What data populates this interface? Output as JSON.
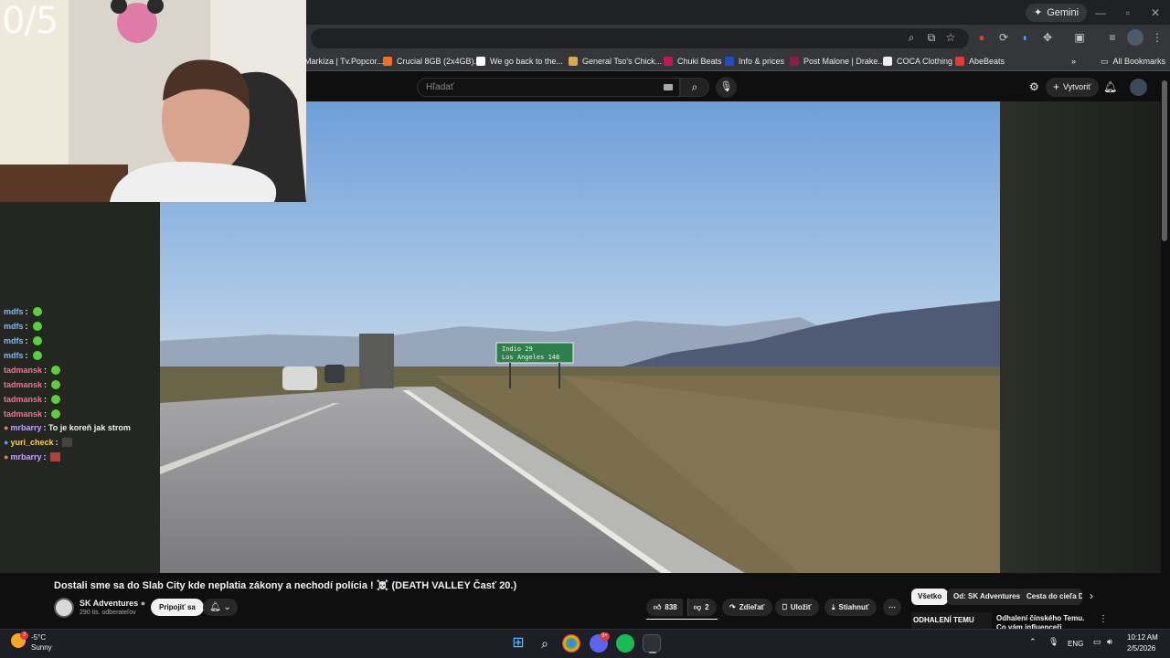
{
  "browser": {
    "gemini_label": "Gemini",
    "bookmarks": [
      "Markíza | Tv.Popcor...",
      "Crucial 8GB (2x4GB)...",
      "We go back to the...",
      "General Tso's Chick...",
      "Chuki Beats",
      "Info & prices",
      "Post Malone | Drake...",
      "COCA Clothing",
      "AbeBeats"
    ],
    "all_bookmarks": "All Bookmarks"
  },
  "youtube": {
    "search_placeholder": "Hľadať",
    "create_label": "Vytvoriť"
  },
  "stream_overlay": {
    "counter": "0/5",
    "chat": [
      {
        "user": "mdfs",
        "text": ":",
        "color": "#7db8ff",
        "emote": true
      },
      {
        "user": "mdfs",
        "text": ":",
        "color": "#7db8ff",
        "emote": true
      },
      {
        "user": "mdfs",
        "text": ":",
        "color": "#7db8ff",
        "emote": true
      },
      {
        "user": "mdfs",
        "text": ":",
        "color": "#7db8ff",
        "emote": true
      },
      {
        "user": "tadmansk",
        "text": ":",
        "color": "#ff6b8a",
        "emote": true
      },
      {
        "user": "tadmansk",
        "text": ":",
        "color": "#ff6b8a",
        "emote": true
      },
      {
        "user": "tadmansk",
        "text": ":",
        "color": "#ff6b8a",
        "emote": true
      },
      {
        "user": "tadmansk",
        "text": ":",
        "color": "#ff6b8a",
        "emote": true
      },
      {
        "user": "mrbarry",
        "text": ": To je koreň jak strom",
        "color": "#c9a3ff",
        "emote": false
      },
      {
        "user": "yuri_check",
        "text": ":",
        "color": "#ffd24d",
        "emote": false
      },
      {
        "user": "mrbarry",
        "text": ":",
        "color": "#c9a3ff",
        "emote": false
      }
    ]
  },
  "video": {
    "sign_lines": [
      "Indio 29",
      "Los Angeles 148"
    ],
    "title": "Dostali sme sa do Slab City kde neplatia zákony a nechodí polícia ! ☠️ (DEATH VALLEY Časť 20.)",
    "channel": "SK Adventures",
    "subscribers": "290 tis. odberateľov",
    "join_label": "Pripojiť sa",
    "likes": "838",
    "dislikes": "2",
    "share_label": "Zdieľať",
    "save_label": "Uložiť",
    "download_label": "Stiahnuť"
  },
  "filters": {
    "chips": [
      "Všetko",
      "Od: SK Adventures",
      "Cesta do cieľa Do..."
    ],
    "next_video_title": "Odhalení čínského Temu. Co vám influenceři neřeknou?",
    "thumb_text": "ODHALENÍ TEMU"
  },
  "taskbar": {
    "weather_temp": "-5°C",
    "weather_text": "Sunny",
    "weather_badge": "3",
    "lang": "ENG",
    "time": "10:12 AM",
    "date": "2/5/2026",
    "discord_badge": "9+"
  }
}
